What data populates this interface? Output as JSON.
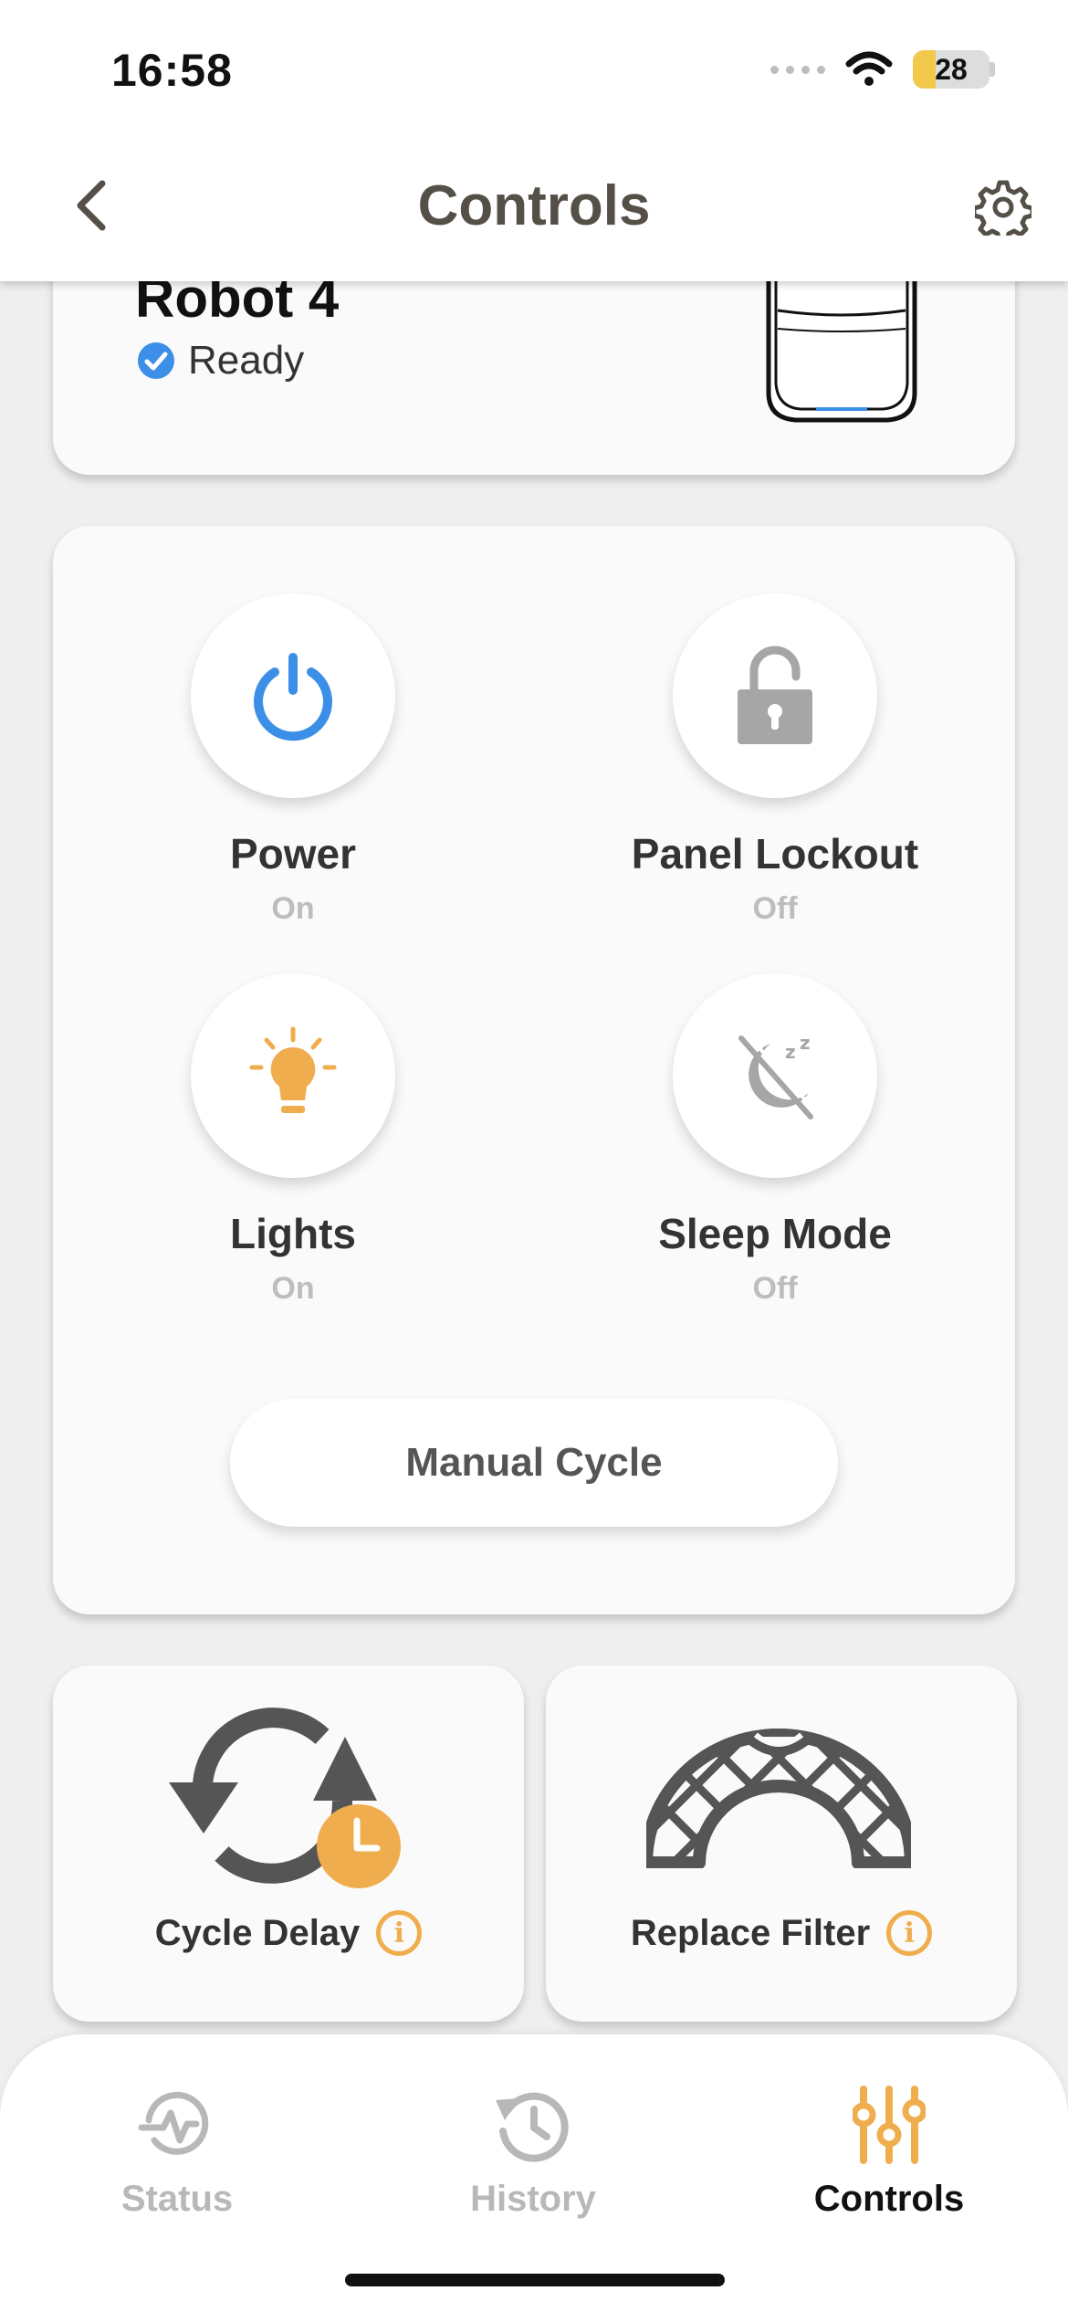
{
  "status_bar": {
    "time": "16:58",
    "battery": "28"
  },
  "header": {
    "title": "Controls"
  },
  "robot": {
    "name": "Robot 4",
    "status": "Ready"
  },
  "controls": [
    {
      "label": "Power",
      "state": "On"
    },
    {
      "label": "Panel Lockout",
      "state": "Off"
    },
    {
      "label": "Lights",
      "state": "On"
    },
    {
      "label": "Sleep Mode",
      "state": "Off"
    }
  ],
  "manual_cycle": {
    "label": "Manual Cycle"
  },
  "cards": {
    "cycle_delay": {
      "label": "Cycle Delay"
    },
    "replace_filter": {
      "label": "Replace Filter"
    }
  },
  "tabbar": {
    "status": "Status",
    "history": "History",
    "controls": "Controls"
  },
  "colors": {
    "accent": "#f0ad4e",
    "power_blue": "#3b8fe6",
    "text_dark": "#333333",
    "muted": "#b8b8b8"
  }
}
